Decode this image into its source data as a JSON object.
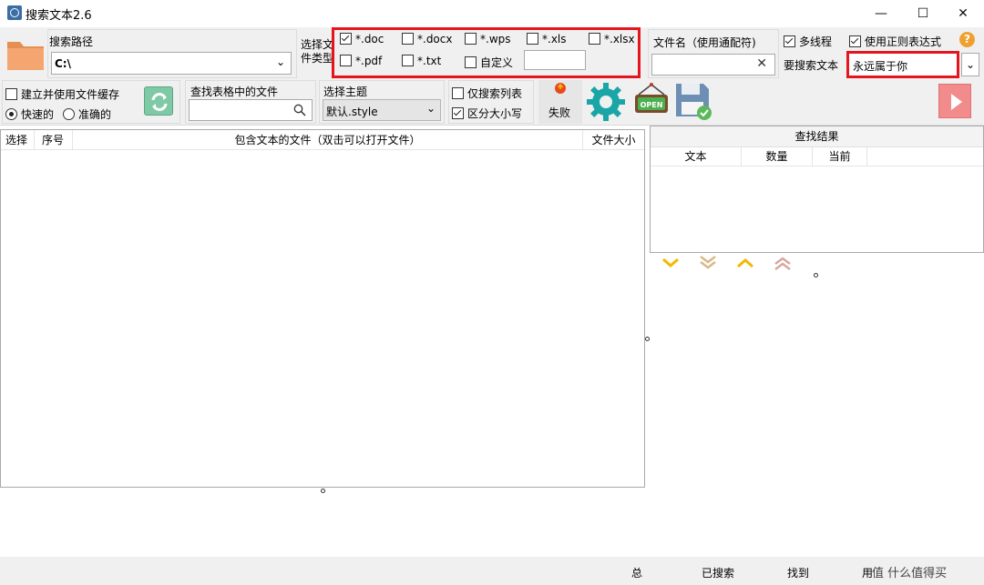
{
  "window": {
    "title": "搜索文本2.6",
    "controls": {
      "minimize": "—",
      "maximize": "☐",
      "close": "✕"
    }
  },
  "search_path": {
    "label": "搜索路径",
    "value": "C:\\"
  },
  "file_types": {
    "label_line1": "选择文",
    "label_line2": "件类型",
    "options": [
      {
        "label": "*.doc",
        "checked": true
      },
      {
        "label": "*.docx",
        "checked": false
      },
      {
        "label": "*.wps",
        "checked": false
      },
      {
        "label": "*.xls",
        "checked": false
      },
      {
        "label": "*.xlsx",
        "checked": false
      },
      {
        "label": "*.pdf",
        "checked": false
      },
      {
        "label": "*.txt",
        "checked": false
      },
      {
        "label": "自定义",
        "checked": false
      }
    ],
    "custom_value": ""
  },
  "filename": {
    "label": "文件名（使用通配符)",
    "value": ""
  },
  "options": {
    "multithread": "多线程",
    "regex": "使用正则表达式",
    "help": "?"
  },
  "search_text": {
    "label": "要搜索文本",
    "value": "永远属于你"
  },
  "cache": {
    "label": "建立并使用文件缓存",
    "fast": "快速的",
    "accurate": "准确的"
  },
  "table_search": {
    "label": "查找表格中的文件",
    "value": ""
  },
  "theme": {
    "label": "选择主题",
    "value": "默认.style"
  },
  "filters": {
    "list_only": "仅搜索列表",
    "case_sensitive": "区分大小写"
  },
  "fail": {
    "label": "失败"
  },
  "file_table": {
    "columns": [
      "选择",
      "序号",
      "包含文本的文件（双击可以打开文件）",
      "文件大小"
    ]
  },
  "results": {
    "title": "查找结果",
    "columns": [
      "文本",
      "数量",
      "当前"
    ]
  },
  "statusbar": {
    "total": "总",
    "searched": "已搜索",
    "found": "找到",
    "used": "用",
    "watermark": "值 什么值得买"
  },
  "colors": {
    "red_highlight": "#e4151c",
    "gear": "#1aa6a6",
    "play": "#f28c8c",
    "folder": "#f0a36b"
  }
}
